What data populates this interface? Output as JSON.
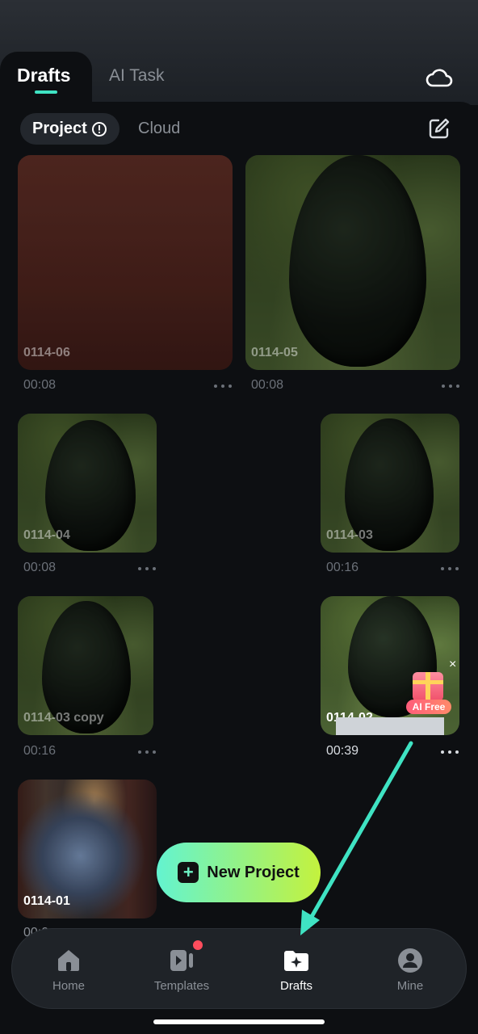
{
  "tabs": [
    {
      "label": "Drafts",
      "active": true
    },
    {
      "label": "AI Task",
      "active": false
    }
  ],
  "segment": {
    "project_label": "Project",
    "cloud_label": "Cloud"
  },
  "projects": [
    {
      "name": "0114-06",
      "duration": "00:08"
    },
    {
      "name": "0114-05",
      "duration": "00:08"
    },
    {
      "name": "0114-04",
      "duration": "00:08"
    },
    {
      "name": "0114-03",
      "duration": "00:16"
    },
    {
      "name": "0114-03 copy",
      "duration": "00:16"
    },
    {
      "name": "0114-02",
      "duration": "00:39"
    },
    {
      "name": "0114-01",
      "duration": "00:0"
    }
  ],
  "promo": {
    "label": "AI Free",
    "close": "×"
  },
  "new_project_label": "New Project",
  "nav": [
    {
      "label": "Home",
      "icon": "home-icon"
    },
    {
      "label": "Templates",
      "icon": "templates-icon",
      "badge": true
    },
    {
      "label": "Drafts",
      "icon": "drafts-folder-icon",
      "active": true
    },
    {
      "label": "Mine",
      "icon": "profile-icon"
    }
  ],
  "colors": {
    "accent": "#3fe3c3",
    "new_project_gradient_start": "#63f3d0",
    "new_project_gradient_end": "#c4f23d",
    "annotation_arrow": "#3fe3c3",
    "badge": "#ff4d5d"
  }
}
